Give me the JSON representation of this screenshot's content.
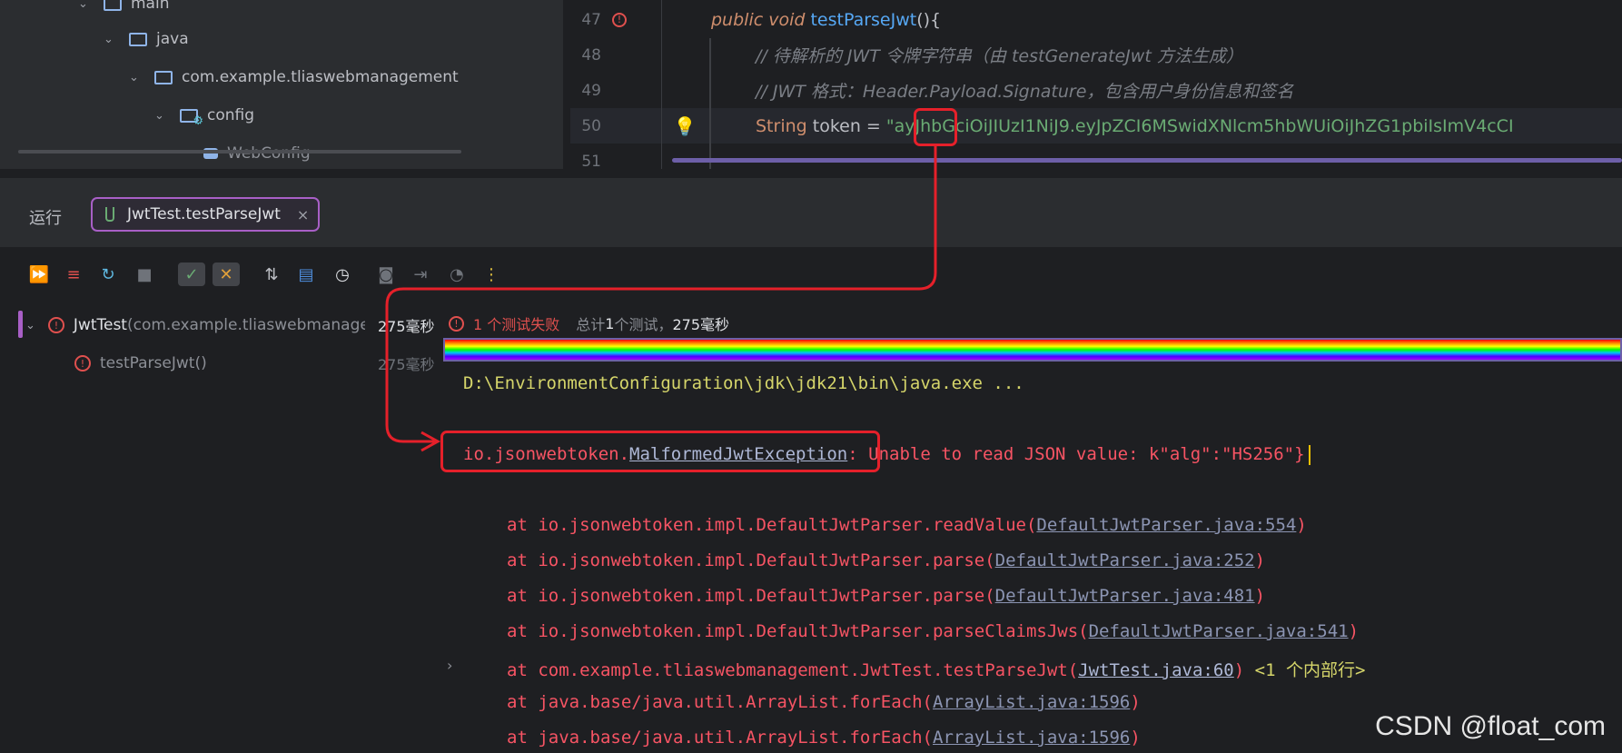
{
  "project_tree": {
    "items": [
      {
        "label": "main",
        "level": 1
      },
      {
        "label": "java",
        "level": 2
      },
      {
        "label": "com.example.tliaswebmanagement",
        "level": 3
      },
      {
        "label": "config",
        "level": 4
      },
      {
        "label": "WebConfig",
        "level": 5
      }
    ]
  },
  "editor": {
    "lines": [
      {
        "num": "47",
        "kw1": "public",
        "kw2": "void",
        "fn": "testParseJwt",
        "rest": "(){"
      },
      {
        "num": "48",
        "comment": "// 待解析的 JWT 令牌字符串（由 testGenerateJwt 方法生成）"
      },
      {
        "num": "49",
        "comment": "// JWT 格式：Header.Payload.Signature，包含用户身份信息和签名"
      },
      {
        "num": "50",
        "type": "String",
        "var": " token = ",
        "string": "\"ayJhbGciOiJIUzI1NiJ9.eyJpZCI6MSwidXNlcm5hbWUiOiJhZG1pbiIsImV4cCI"
      },
      {
        "num": "51"
      }
    ]
  },
  "run_panel": {
    "label": "运行",
    "tab_label": "JwtTest.testParseJwt",
    "close_glyph": "×"
  },
  "toolbar": {
    "icons": [
      "rerun-all-icon",
      "rerun-failed-icon",
      "toggle-auto-test-icon",
      "stop-icon",
      "show-passed-icon",
      "show-ignored-icon",
      "sort-icon",
      "import-tests-icon",
      "history-icon",
      "screenshot-icon",
      "export-icon",
      "coverage-icon",
      "more-icon"
    ]
  },
  "test_tree": {
    "root": {
      "name": "JwtTest",
      "pkg": " (com.example.tliaswebmanageme",
      "time": "275毫秒"
    },
    "child": {
      "name": "testParseJwt()",
      "time": "275毫秒"
    }
  },
  "status": {
    "failed": "1 个测试失败",
    "summary_prefix": "总计 ",
    "summary_count": "1",
    "summary_mid": " 个测试，",
    "summary_time": "275毫秒"
  },
  "console": {
    "cmd": "D:\\EnvironmentConfiguration\\jdk\\jdk21\\bin\\java.exe ...",
    "exception_pkg": "io.jsonwebtoken.",
    "exception_class": "MalformedJwtException",
    "exception_msg": ": Unable to read JSON value: k\"alg\":\"HS256\"}",
    "stack": [
      {
        "prefix": "at io.jsonwebtoken.impl.DefaultJwtParser.readValue(",
        "link": "DefaultJwtParser.java:554",
        "suffix": ")"
      },
      {
        "prefix": "at io.jsonwebtoken.impl.DefaultJwtParser.parse(",
        "link": "DefaultJwtParser.java:252",
        "suffix": ")"
      },
      {
        "prefix": "at io.jsonwebtoken.impl.DefaultJwtParser.parse(",
        "link": "DefaultJwtParser.java:481",
        "suffix": ")"
      },
      {
        "prefix": "at io.jsonwebtoken.impl.DefaultJwtParser.parseClaimsJws(",
        "link": "DefaultJwtParser.java:541",
        "suffix": ")"
      },
      {
        "prefix": "at com.example.tliaswebmanagement.JwtTest.testParseJwt(",
        "link": "JwtTest.java:60",
        "suffix": ")",
        "extra": " <1 个内部行>"
      },
      {
        "prefix": "at java.base/java.util.ArrayList.forEach(",
        "link": "ArrayList.java:1596",
        "suffix": ")"
      },
      {
        "prefix": "at java.base/java.util.ArrayList.forEach(",
        "link": "ArrayList.java:1596",
        "suffix": ")"
      }
    ]
  },
  "watermark": "CSDN @float_com",
  "colors": {
    "accent": "#a85fc6",
    "error": "#f75464",
    "annotation": "#e5202a"
  }
}
